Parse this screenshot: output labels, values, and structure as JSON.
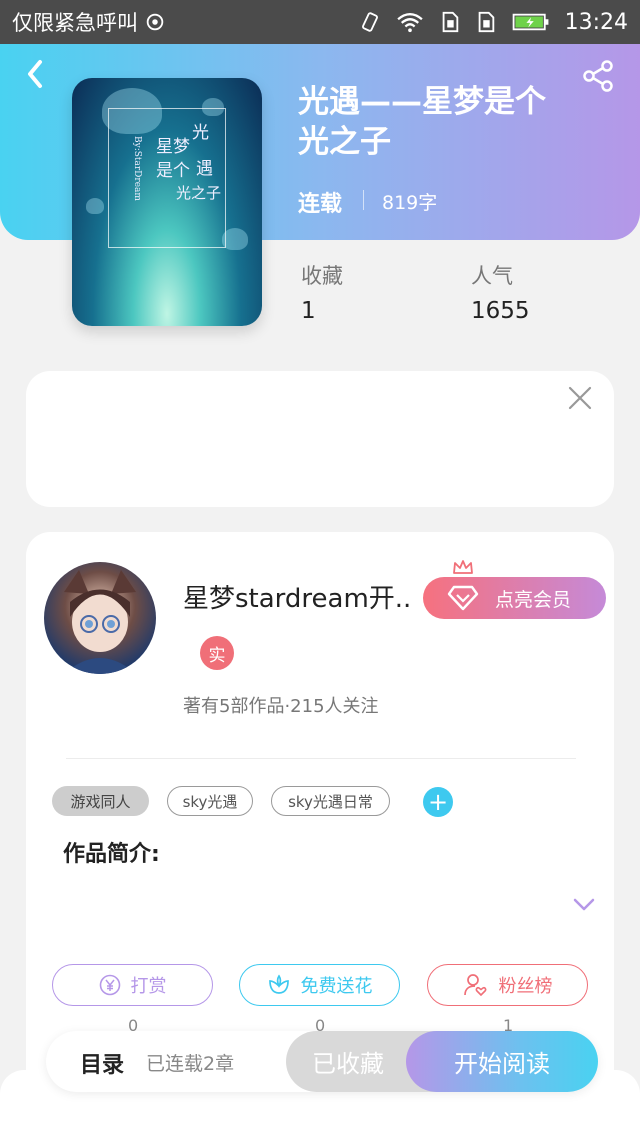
{
  "status_bar": {
    "carrier": "仅限紧急呼叫",
    "time": "13:24"
  },
  "book": {
    "title": "光遇——星梦是个光之子",
    "status": "连载",
    "word_count": "819字",
    "cover_text": {
      "line1": "光",
      "line2": "遇",
      "line3": "星梦",
      "line4": "是个",
      "line5": "光之子",
      "credit": "By:StarDream"
    }
  },
  "stats": {
    "favorites_label": "收藏",
    "favorites_value": "1",
    "popularity_label": "人气",
    "popularity_value": "1655"
  },
  "author": {
    "name": "星梦stardream开...",
    "vip_button": "点亮会员",
    "real_badge": "实",
    "meta": "著有5部作品·215人关注"
  },
  "tags": [
    "游戏同人",
    "sky光遇",
    "sky光遇日常"
  ],
  "tag_add": "+",
  "intro_label": "作品简介:",
  "actions": [
    {
      "label": "打赏",
      "count": "0",
      "color": "#b597e8"
    },
    {
      "label": "免费送花",
      "count": "0",
      "color": "#3ec9ef"
    },
    {
      "label": "粉丝榜",
      "count": "1",
      "color": "#f06f78"
    }
  ],
  "bottom_bar": {
    "toc_label": "目录",
    "toc_count": "已连载2章",
    "collected_label": "已收藏",
    "read_label": "开始阅读"
  }
}
